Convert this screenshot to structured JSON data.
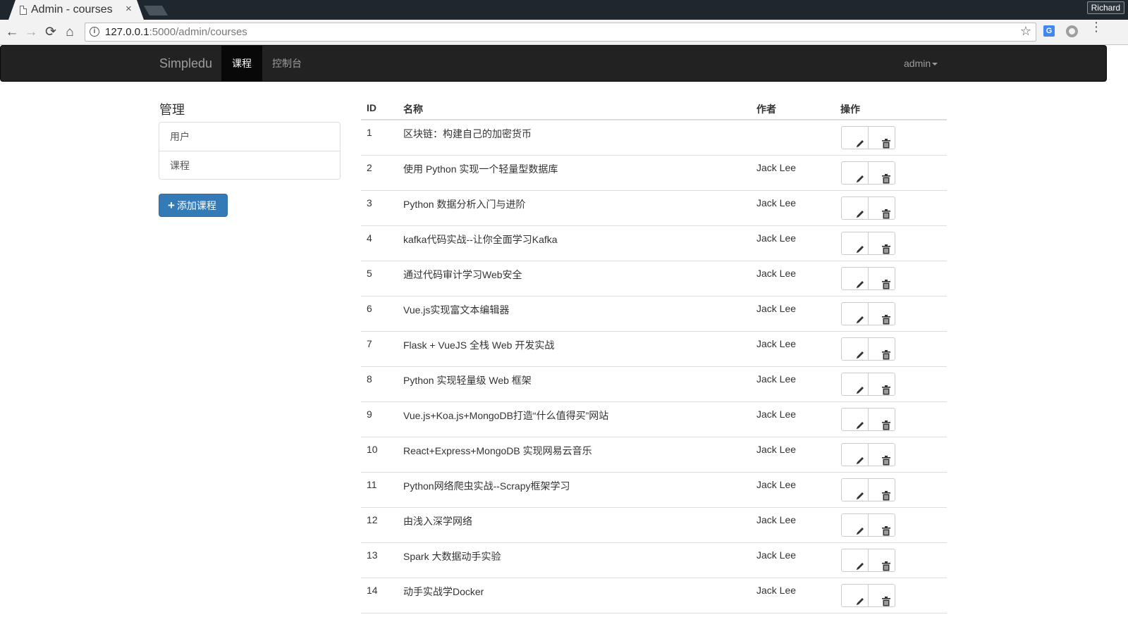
{
  "browser": {
    "tab_title": "Admin - courses",
    "tab_close": "×",
    "profile_name": "Richard",
    "url_host": "127.0.0.1",
    "url_path": ":5000/admin/courses",
    "back_icon": "←",
    "forward_icon": "→",
    "reload_icon": "⟳",
    "home_icon": "⌂",
    "star_icon": "☆",
    "translate_icon": "G",
    "menu_icon": "⋮"
  },
  "navbar": {
    "brand": "Simpledu",
    "links": [
      {
        "label": "课程",
        "active": true
      },
      {
        "label": "控制台",
        "active": false
      }
    ],
    "user_menu": "admin"
  },
  "sidebar": {
    "title": "管理",
    "items": [
      {
        "label": "用户"
      },
      {
        "label": "课程"
      }
    ],
    "add_button_icon": "+",
    "add_button": "添加课程"
  },
  "table": {
    "headers": {
      "id": "ID",
      "name": "名称",
      "author": "作者",
      "ops": "操作"
    },
    "rows": [
      {
        "id": "1",
        "name": "区块链：构建自己的加密货币",
        "author": ""
      },
      {
        "id": "2",
        "name": "使用 Python 实现一个轻量型数据库",
        "author": "Jack Lee"
      },
      {
        "id": "3",
        "name": "Python 数据分析入门与进阶",
        "author": "Jack Lee"
      },
      {
        "id": "4",
        "name": "kafka代码实战--让你全面学习Kafka",
        "author": "Jack Lee"
      },
      {
        "id": "5",
        "name": "通过代码审计学习Web安全",
        "author": "Jack Lee"
      },
      {
        "id": "6",
        "name": "Vue.js实现富文本编辑器",
        "author": "Jack Lee"
      },
      {
        "id": "7",
        "name": "Flask + VueJS 全栈 Web 开发实战",
        "author": "Jack Lee"
      },
      {
        "id": "8",
        "name": "Python 实现轻量级 Web 框架",
        "author": "Jack Lee"
      },
      {
        "id": "9",
        "name": "Vue.js+Koa.js+MongoDB打造“什么值得买”网站",
        "author": "Jack Lee"
      },
      {
        "id": "10",
        "name": "React+Express+MongoDB 实现网易云音乐",
        "author": "Jack Lee"
      },
      {
        "id": "11",
        "name": "Python网络爬虫实战--Scrapy框架学习",
        "author": "Jack Lee"
      },
      {
        "id": "12",
        "name": "由浅入深学网络",
        "author": "Jack Lee"
      },
      {
        "id": "13",
        "name": "Spark 大数据动手实验",
        "author": "Jack Lee"
      },
      {
        "id": "14",
        "name": "动手实战学Docker",
        "author": "Jack Lee"
      }
    ],
    "edit_icon": "pencil-icon",
    "delete_icon": "trash-icon"
  },
  "colors": {
    "navbar_bg": "#222222",
    "primary": "#337ab7",
    "chrome_dark": "#1f272e"
  }
}
